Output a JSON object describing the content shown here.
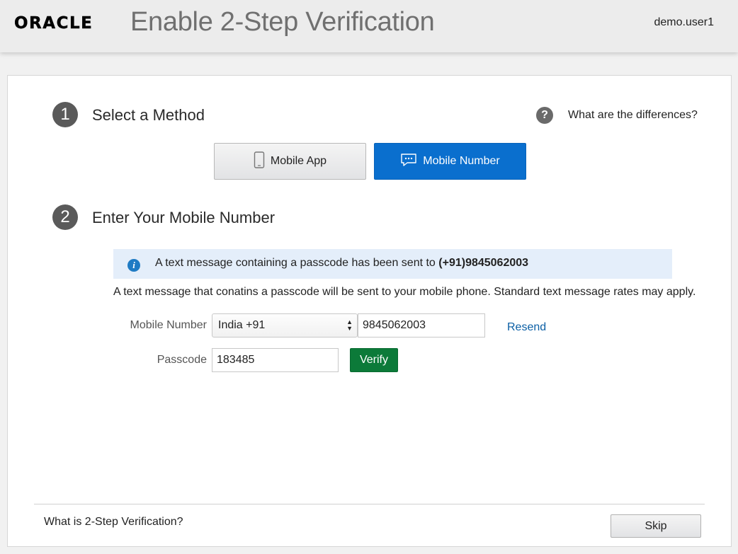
{
  "header": {
    "logo": "ORACLE",
    "title": "Enable 2-Step Verification",
    "username": "demo.user1"
  },
  "step1": {
    "number": "1",
    "title": "Select a Method",
    "help_link": "What are the differences?",
    "methods": [
      {
        "label": "Mobile App",
        "icon": "phone-icon",
        "selected": false
      },
      {
        "label": "Mobile Number",
        "icon": "chat-bubble-icon",
        "selected": true
      }
    ]
  },
  "step2": {
    "number": "2",
    "title": "Enter Your Mobile Number",
    "info_prefix": "A text message containing a passcode has been sent to ",
    "info_number": "(+91)9845062003",
    "note": "A text message that conatins a passcode will be sent to your mobile phone. Standard text message rates may apply.",
    "mobile_label": "Mobile Number",
    "country_value": "India +91",
    "phone_value": "9845062003",
    "resend_label": "Resend",
    "passcode_label": "Passcode",
    "passcode_value": "183485",
    "verify_label": "Verify"
  },
  "footer": {
    "what_link": "What is 2-Step Verification?",
    "skip_label": "Skip"
  },
  "colors": {
    "selected_method": "#0a6fce",
    "verify": "#0c7a39",
    "info_banner": "#e4eefa",
    "link": "#0b5fa5"
  }
}
